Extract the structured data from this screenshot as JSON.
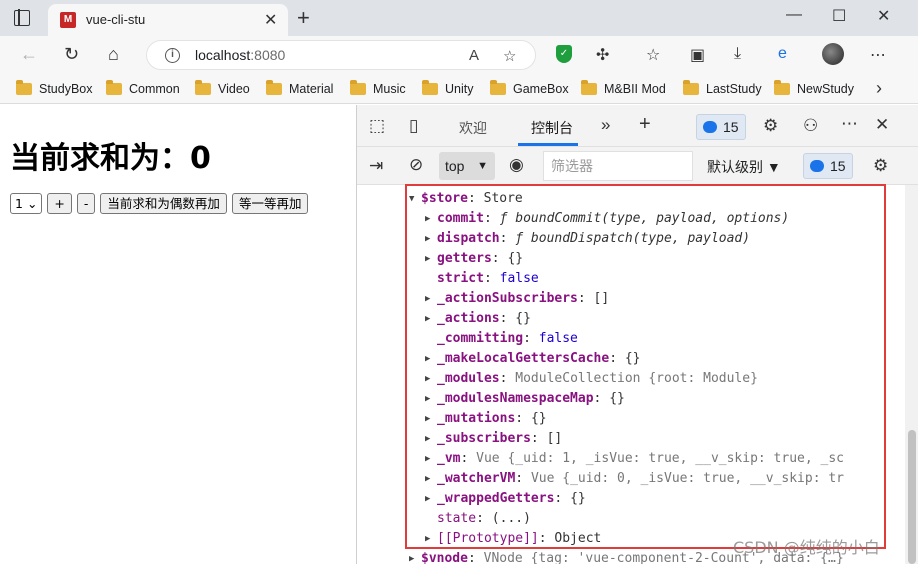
{
  "browser": {
    "tab_title": "vue-cli-stu",
    "favicon_text": "M",
    "url_host": "localhost",
    "url_port": ":8080",
    "new_tab_symbol": "+",
    "icons": [
      "tab-actions-icon",
      "back-icon",
      "reload-icon",
      "home-icon",
      "info-icon",
      "read-aloud-icon",
      "add-favorite-icon",
      "shield-icon",
      "extensions-icon",
      "favorites-icon",
      "collections-icon",
      "download-icon",
      "edge-icon",
      "profile-avatar",
      "more-icon",
      "minimize-icon",
      "maximize-icon",
      "close-icon"
    ]
  },
  "bookmarks": [
    {
      "label": "StudyBox"
    },
    {
      "label": "Common"
    },
    {
      "label": "Video"
    },
    {
      "label": "Material"
    },
    {
      "label": "Music"
    },
    {
      "label": "Unity"
    },
    {
      "label": "GameBox"
    },
    {
      "label": "M&BII Mod"
    },
    {
      "label": "LastStudy"
    },
    {
      "label": "NewStudy"
    }
  ],
  "page": {
    "heading": "当前求和为：0",
    "select_value": "1",
    "increment_label": "+",
    "decrement_label": "-",
    "odd_add_label": "当前求和为偶数再加",
    "wait_add_label": "等一等再加"
  },
  "devtools": {
    "tab_welcome": "欢迎",
    "tab_console": "控制台",
    "issues_count": "15",
    "context": "top",
    "filter_placeholder": "筛选器",
    "levels_label": "默认级别",
    "filter_issues_count": "15"
  },
  "console": {
    "lines": [
      {
        "indent": 0,
        "arrow": "▼",
        "key": "$store",
        "sep": ": ",
        "value": "Store",
        "vclass": "c",
        "kclass": "k"
      },
      {
        "indent": 1,
        "arrow": "▶",
        "key": "commit",
        "sep": ": ",
        "value": "ƒ boundCommit(type, payload, options)",
        "vclass": "fi",
        "kclass": "k"
      },
      {
        "indent": 1,
        "arrow": "▶",
        "key": "dispatch",
        "sep": ": ",
        "value": "ƒ boundDispatch(type, payload)",
        "vclass": "fi",
        "kclass": "k"
      },
      {
        "indent": 1,
        "arrow": "▶",
        "key": "getters",
        "sep": ": ",
        "value": "{}",
        "vclass": "c",
        "kclass": "k"
      },
      {
        "indent": 1,
        "arrow": "",
        "key": "strict",
        "sep": ": ",
        "value": "false",
        "vclass": "b",
        "kclass": "k"
      },
      {
        "indent": 1,
        "arrow": "▶",
        "key": "_actionSubscribers",
        "sep": ": ",
        "value": "[]",
        "vclass": "c",
        "kclass": "k"
      },
      {
        "indent": 1,
        "arrow": "▶",
        "key": "_actions",
        "sep": ": ",
        "value": "{}",
        "vclass": "c",
        "kclass": "k"
      },
      {
        "indent": 1,
        "arrow": "",
        "key": "_committing",
        "sep": ": ",
        "value": "false",
        "vclass": "b",
        "kclass": "k"
      },
      {
        "indent": 1,
        "arrow": "▶",
        "key": "_makeLocalGettersCache",
        "sep": ": ",
        "value": "{}",
        "vclass": "c",
        "kclass": "k"
      },
      {
        "indent": 1,
        "arrow": "▶",
        "key": "_modules",
        "sep": ": ",
        "value": "ModuleCollection {root: Module}",
        "vclass": "g",
        "kclass": "k"
      },
      {
        "indent": 1,
        "arrow": "▶",
        "key": "_modulesNamespaceMap",
        "sep": ": ",
        "value": "{}",
        "vclass": "c",
        "kclass": "k"
      },
      {
        "indent": 1,
        "arrow": "▶",
        "key": "_mutations",
        "sep": ": ",
        "value": "{}",
        "vclass": "c",
        "kclass": "k"
      },
      {
        "indent": 1,
        "arrow": "▶",
        "key": "_subscribers",
        "sep": ": ",
        "value": "[]",
        "vclass": "c",
        "kclass": "k"
      },
      {
        "indent": 1,
        "arrow": "▶",
        "key": "_vm",
        "sep": ": ",
        "value": "Vue {_uid: 1, _isVue: true, __v_skip: true, _sc",
        "vclass": "g",
        "kclass": "k"
      },
      {
        "indent": 1,
        "arrow": "▶",
        "key": "_watcherVM",
        "sep": ": ",
        "value": "Vue {_uid: 0, _isVue: true, __v_skip: tr",
        "vclass": "g",
        "kclass": "k"
      },
      {
        "indent": 1,
        "arrow": "▶",
        "key": "_wrappedGetters",
        "sep": ": ",
        "value": "{}",
        "vclass": "c",
        "kclass": "k"
      },
      {
        "indent": 1,
        "arrow": "",
        "key": "state",
        "sep": ": ",
        "value": "(...)",
        "vclass": "c",
        "kclass": "kn"
      },
      {
        "indent": 1,
        "arrow": "▶",
        "key": "[[Prototype]]",
        "sep": ": ",
        "value": "Object",
        "vclass": "c",
        "kclass": "kn"
      },
      {
        "indent": -1,
        "arrow": "▶",
        "key": "$vnode",
        "sep": ": ",
        "value": "VNode {tag: 'vue-component-2-Count', data: {…}",
        "vclass": "g",
        "kclass": "k"
      }
    ]
  },
  "watermark": "CSDN @纯纯的小白",
  "colors": {
    "highlight_border": "#e03c3c",
    "active_tab_underline": "#1a73e8",
    "key_purple": "#881280",
    "boolean_blue": "#1c00cf"
  }
}
